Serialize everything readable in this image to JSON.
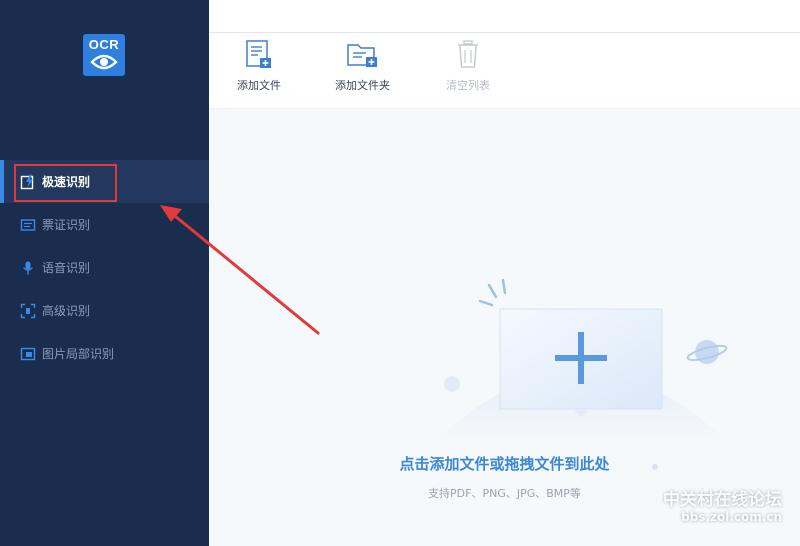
{
  "sidebar": {
    "logo_text": "OCR",
    "items": [
      {
        "label": "极速识别",
        "active": true
      },
      {
        "label": "票证识别"
      },
      {
        "label": "语音识别"
      },
      {
        "label": "高级识别"
      },
      {
        "label": "图片局部识别"
      }
    ]
  },
  "toolbar": {
    "add_file": "添加文件",
    "add_folder": "添加文件夹",
    "clear_list": "清空列表"
  },
  "dropzone": {
    "title": "点击添加文件或拖拽文件到此处",
    "subtitle": "支持PDF、PNG、JPG、BMP等"
  },
  "watermark": {
    "title": "中关村在线论坛",
    "url": "bbs.zol.com.cn"
  },
  "colors": {
    "sidebar_bg": "#1b2d4f",
    "accent": "#3b8ae8",
    "highlight": "#e03a3a"
  }
}
